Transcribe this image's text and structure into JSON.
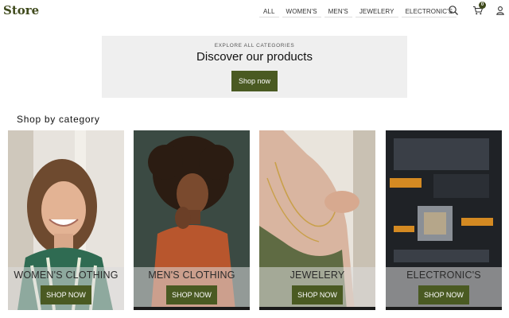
{
  "header": {
    "brand": "Store",
    "nav": [
      "ALL",
      "WOMEN'S",
      "MEN'S",
      "JEWELERY",
      "ELECTRONIC'S"
    ],
    "cart_count": "0",
    "icons": [
      "search-icon",
      "cart-icon",
      "user-icon"
    ]
  },
  "hero": {
    "kicker": "EXPLORE ALL CATEGORIES",
    "title": "Discover our products",
    "button": "Shop now"
  },
  "section": {
    "title": "Shop by category"
  },
  "categories": [
    {
      "label": "WOMEN'S CLOTHING",
      "button": "SHOP NOW"
    },
    {
      "label": "MEN'S CLOTHING",
      "button": "SHOP NOW"
    },
    {
      "label": "JEWELERY",
      "button": "SHOP NOW"
    },
    {
      "label": "ELECTRONIC'S",
      "button": "SHOP NOW"
    }
  ],
  "colors": {
    "accent": "#4a5a22",
    "brand": "#3f4a1c",
    "hero_bg": "#efefef"
  }
}
